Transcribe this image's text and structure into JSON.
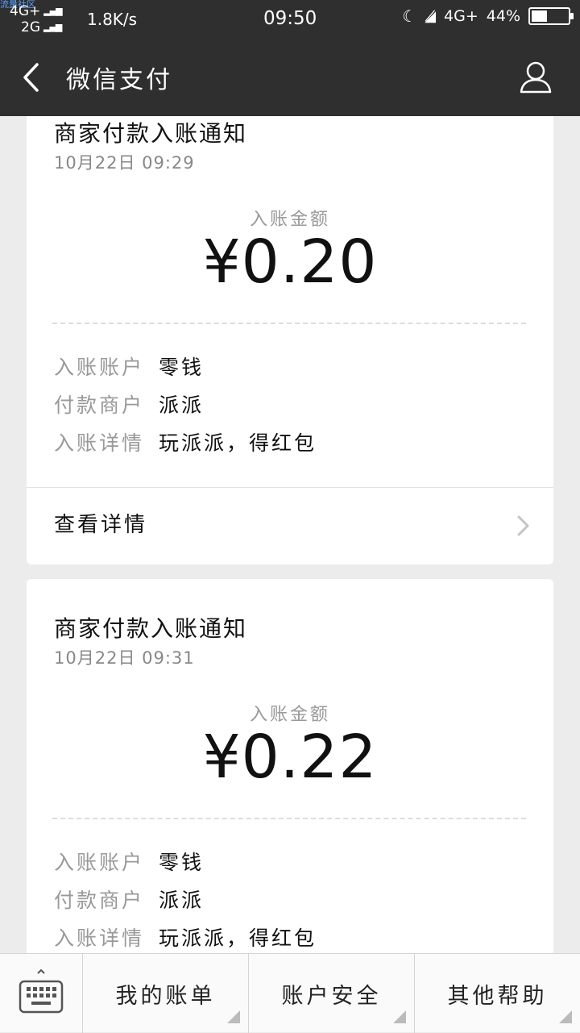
{
  "status_bar": {
    "watermark": "流量社区",
    "network_1": "4G+",
    "network_2": "2G",
    "speed": "1.8K/s",
    "time": "09:50",
    "network_3": "4G+",
    "battery": "44%",
    "battery_level": 0.44
  },
  "nav": {
    "title": "微信支付"
  },
  "cards": [
    {
      "title": "商家付款入账通知",
      "date": "10月22日  09:29",
      "amount_label": "入账金额",
      "amount": "¥0.20",
      "rows": [
        {
          "k": "入账账户",
          "v": "零钱"
        },
        {
          "k": "付款商户",
          "v": "派派"
        },
        {
          "k": "入账详情",
          "v": "玩派派，得红包"
        }
      ],
      "detail_label": "查看详情"
    },
    {
      "title": "商家付款入账通知",
      "date": "10月22日  09:31",
      "amount_label": "入账金额",
      "amount": "¥0.22",
      "rows": [
        {
          "k": "入账账户",
          "v": "零钱"
        },
        {
          "k": "付款商户",
          "v": "派派"
        },
        {
          "k": "入账详情",
          "v": "玩派派，得红包"
        }
      ]
    }
  ],
  "bottom_menu": {
    "items": [
      "我的账单",
      "账户安全",
      "其他帮助"
    ]
  },
  "icons": {
    "back": "back-arrow-icon",
    "user": "user-icon",
    "keyboard": "keyboard-icon",
    "chevron": "chevron-right-icon"
  }
}
